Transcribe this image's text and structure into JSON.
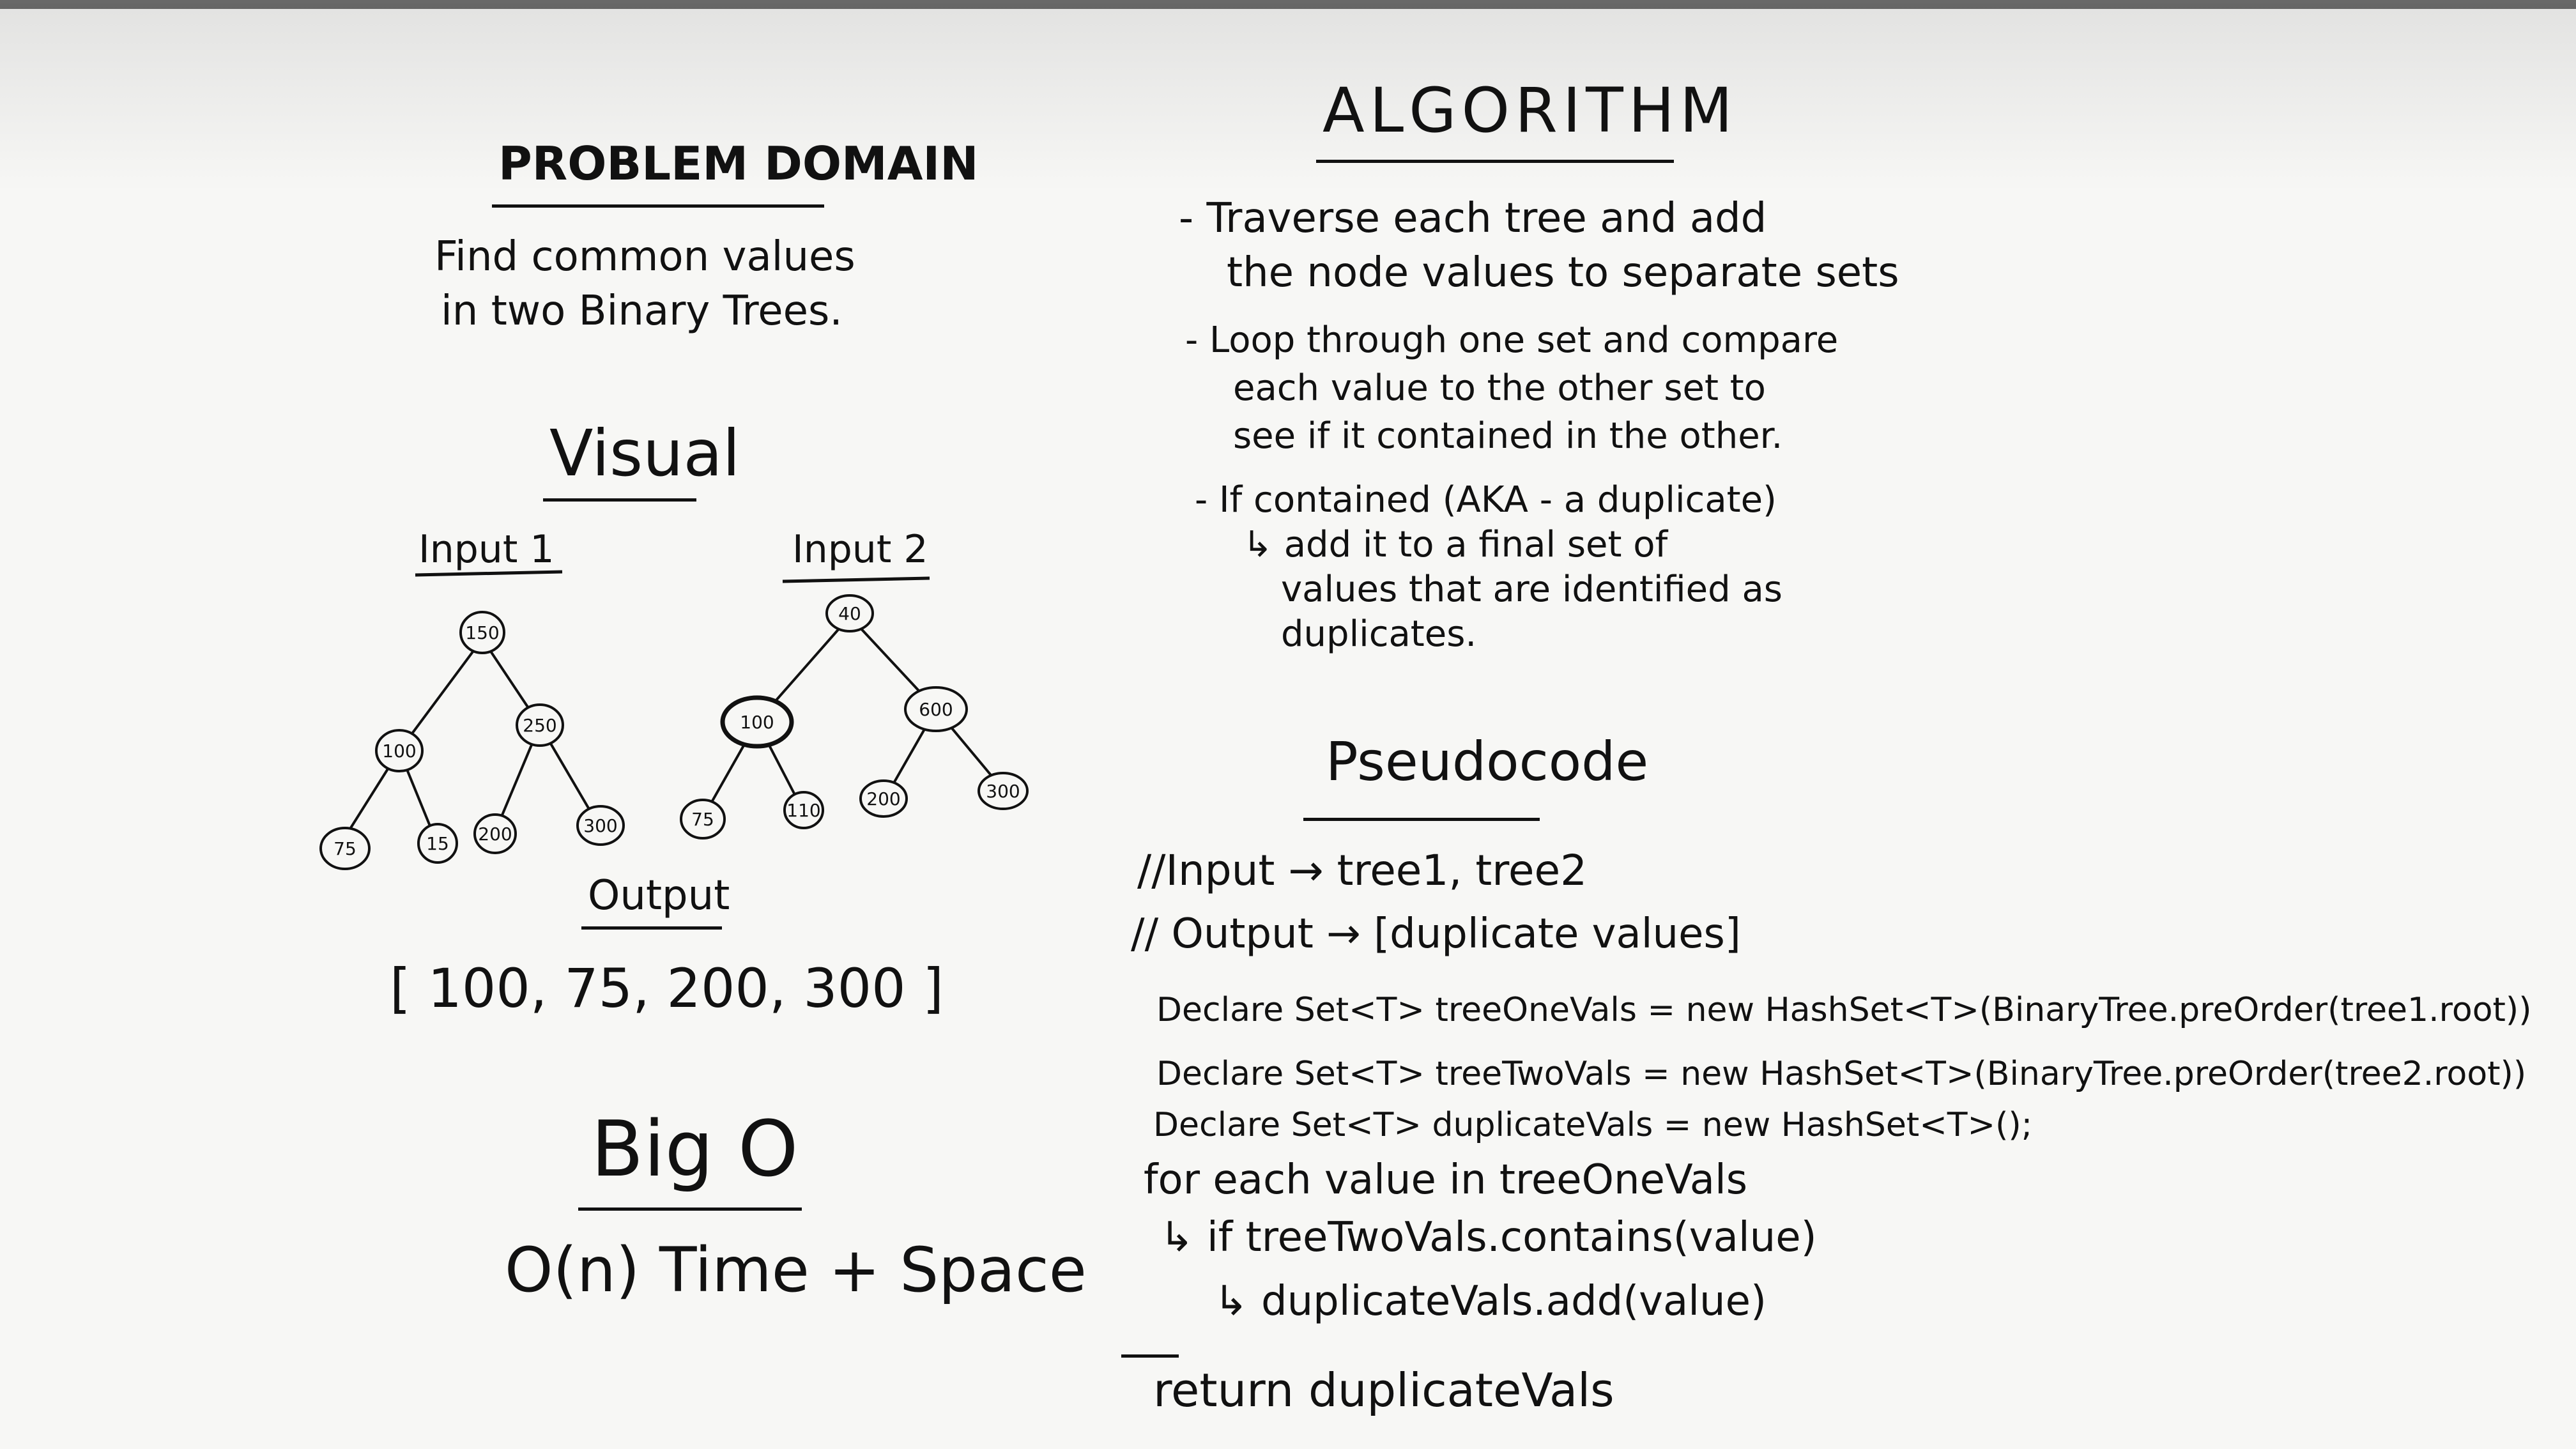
{
  "problem_domain": {
    "title": "PROBLEM DOMAIN",
    "lines": [
      "Find common values",
      "in two Binary Trees."
    ]
  },
  "visual": {
    "title": "Visual",
    "input1": {
      "label": "Input 1",
      "nodes": {
        "root": "150",
        "left": "100",
        "right": "250",
        "ll": "75",
        "lr": "15",
        "rl": "200",
        "rr": "300"
      }
    },
    "input2": {
      "label": "Input 2",
      "nodes": {
        "root": "40",
        "left": "100",
        "right": "600",
        "ll": "75",
        "lr": "110",
        "rl": "200",
        "rr": "300"
      }
    }
  },
  "output": {
    "title": "Output",
    "value": "[ 100, 75, 200, 300 ]"
  },
  "big_o": {
    "title": "Big O",
    "value": "O(n) Time + Space"
  },
  "algorithm": {
    "title": "ALGORITHM",
    "bullets": [
      [
        "- Traverse each tree and add",
        "the node values to separate sets"
      ],
      [
        "- Loop through one set and compare",
        "each value to the other set to",
        "see if it contained in the other."
      ],
      [
        "- If contained (AKA - a duplicate)",
        "↳ add it to a final set of",
        "values that are identified as",
        "duplicates."
      ]
    ]
  },
  "pseudocode": {
    "title": "Pseudocode",
    "lines": [
      "//Input → tree1, tree2",
      "// Output → [duplicate values]",
      "Declare Set<T> treeOneVals = new HashSet<T>(BinaryTree.preOrder(tree1.root))",
      "Declare Set<T> treeTwoVals = new HashSet<T>(BinaryTree.preOrder(tree2.root))",
      "Declare Set<T> duplicateVals = new HashSet<T>();",
      "for each value in treeOneVals",
      "↳ if treeTwoVals.contains(value)",
      "↳ duplicateVals.add(value)",
      "return duplicateVals"
    ]
  }
}
